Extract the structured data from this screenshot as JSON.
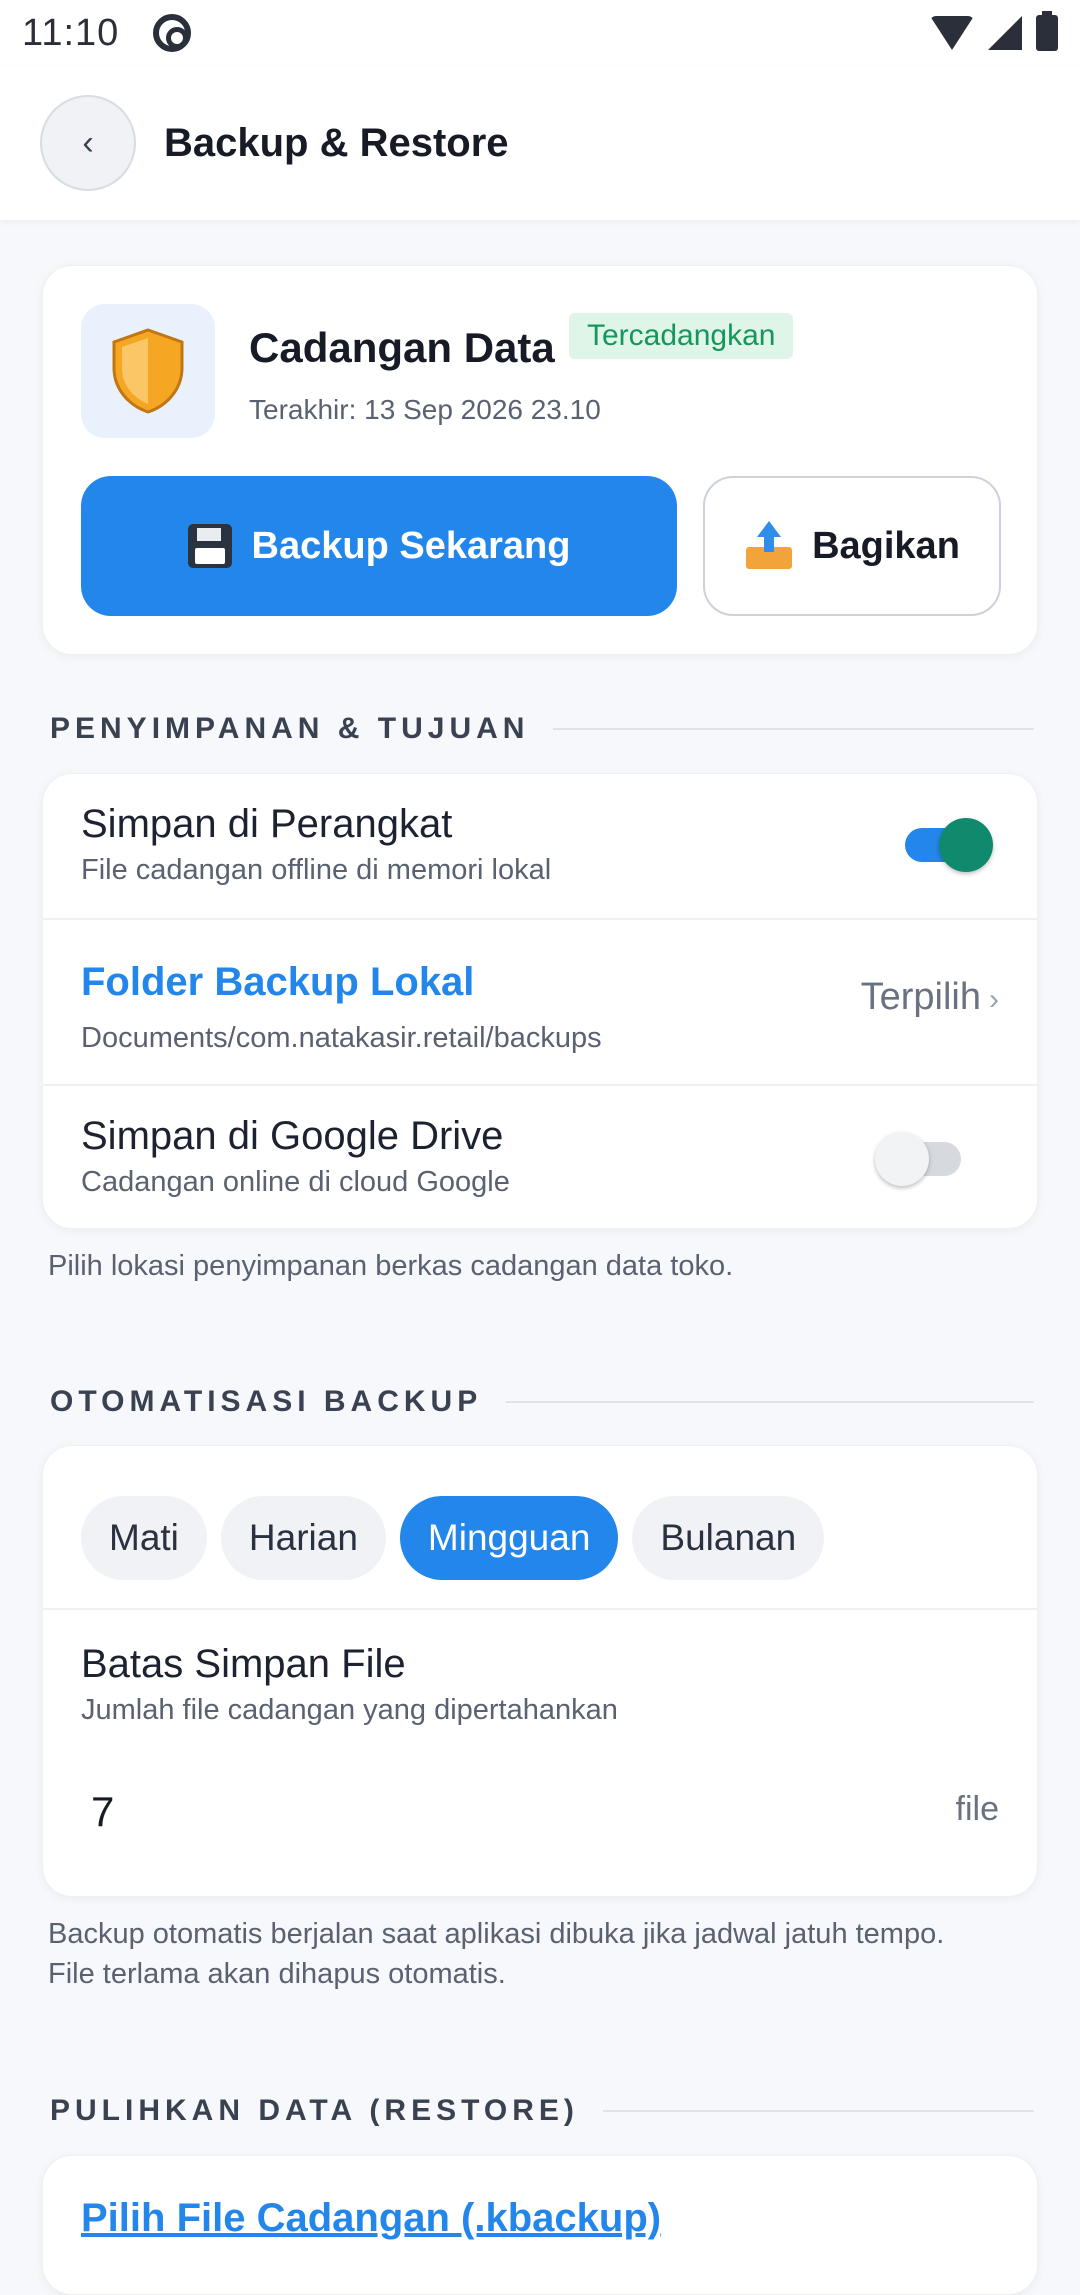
{
  "status_bar": {
    "time": "11:10",
    "icons": [
      "at-sign-icon",
      "wifi-icon",
      "signal-icon",
      "battery-icon"
    ]
  },
  "header": {
    "back_icon": "‹",
    "title": "Backup & Restore"
  },
  "backup_card": {
    "icon": "shield-icon",
    "title": "Cadangan Data",
    "badge": "Tercadangkan",
    "last_backup": "Terakhir: 13 Sep 2026 23.10",
    "primary_button": "Backup Sekarang",
    "secondary_button": "Bagikan"
  },
  "storage": {
    "section_title": "PENYIMPANAN & TUJUAN",
    "device": {
      "label": "Simpan di Perangkat",
      "description": "File cadangan offline di memori lokal",
      "enabled": true
    },
    "folder": {
      "label": "Folder Backup Lokal",
      "path": "Documents/com.natakasir.retail/backups",
      "value": "Terpilih",
      "chevron": "›"
    },
    "gdrive": {
      "label": "Simpan di Google Drive",
      "description": "Cadangan online di cloud Google",
      "enabled": false
    },
    "helper": "Pilih lokasi penyimpanan berkas cadangan data toko."
  },
  "automation": {
    "section_title": "OTOMATISASI BACKUP",
    "options": [
      "Mati",
      "Harian",
      "Mingguan",
      "Bulanan"
    ],
    "selected": "Mingguan",
    "limit_label": "Batas Simpan File",
    "limit_description": "Jumlah file cadangan yang dipertahankan",
    "limit_value": "7",
    "limit_unit": "file",
    "helper_line1": "Backup otomatis berjalan saat aplikasi dibuka jika jadwal jatuh tempo.",
    "helper_line2": "File terlama akan dihapus otomatis."
  },
  "restore": {
    "section_title": "PULIHKAN DATA (RESTORE)",
    "pick_file": "Pilih File Cadangan (.kbackup)"
  },
  "colors": {
    "accent": "#2386ea",
    "toggle_knob_on": "#0f8a6d",
    "badge_bg": "#dff5e8",
    "badge_text": "#16965a",
    "background": "#f6f8fb"
  }
}
